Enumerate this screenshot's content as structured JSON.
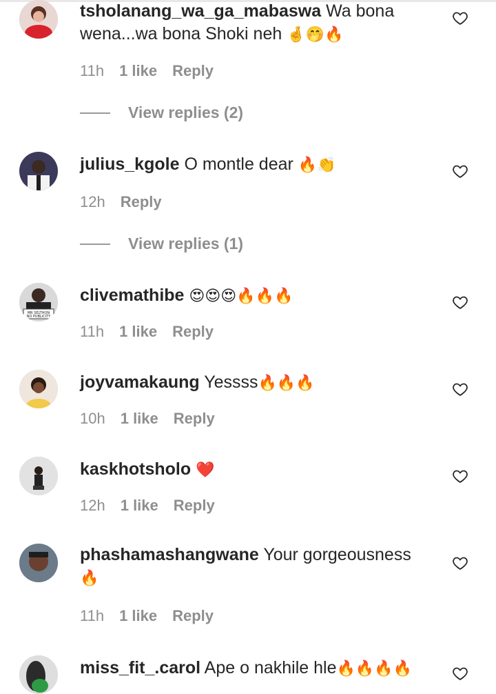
{
  "comments": [
    {
      "username": "tsholanang_wa_ga_mabaswa",
      "text": "Wa bona wena...wa bona Shoki neh",
      "emoji": "🤞🤭🔥",
      "time": "11h",
      "likes": "1 like",
      "reply": "Reply",
      "view_replies": "View replies (2)"
    },
    {
      "username": "julius_kgole",
      "text": "O montle dear",
      "emoji": "🔥👏",
      "time": "12h",
      "likes": "",
      "reply": "Reply",
      "view_replies": "View replies (1)"
    },
    {
      "username": "clivemathibe",
      "text": "",
      "emoji": "😍😍😍🔥🔥🔥",
      "time": "11h",
      "likes": "1 like",
      "reply": "Reply"
    },
    {
      "username": "joyvamakaung",
      "text": "Yessss",
      "emoji": "🔥🔥🔥",
      "time": "10h",
      "likes": "1 like",
      "reply": "Reply"
    },
    {
      "username": "kaskhotsholo",
      "text": "",
      "emoji": "❤️",
      "time": "12h",
      "likes": "1 like",
      "reply": "Reply"
    },
    {
      "username": "phashamashangwane",
      "text": "Your gorgeousness",
      "emoji": "🔥",
      "time": "11h",
      "likes": "1 like",
      "reply": "Reply"
    },
    {
      "username": "miss_fit_.carol",
      "text": "Ape o nakhile hle",
      "emoji": "🔥🔥🔥🔥",
      "time": "",
      "likes": "",
      "reply": ""
    }
  ],
  "avatar_texts": {
    "clivemathibe": "MR SELTHON NO PUBLICITY"
  },
  "icons": {
    "heart": "heart-outline-icon"
  },
  "colors": {
    "text": "#262626",
    "muted": "#8e8e8e",
    "fire": "#f4511e",
    "heart_red": "#ed4956"
  }
}
